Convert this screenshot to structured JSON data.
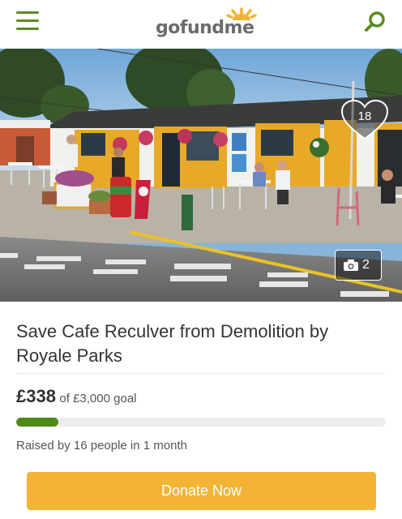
{
  "header": {
    "menu_icon": "hamburger-menu-icon",
    "logo": {
      "part1": "go",
      "part2": "fund",
      "part3": "me"
    },
    "search_icon": "search-icon",
    "brand_color": "#5d8a22"
  },
  "hero": {
    "like_count": "18",
    "like_icon": "heart-icon",
    "photo_icon": "camera-icon",
    "photo_count": "2"
  },
  "campaign": {
    "title": "Save Cafe Reculver from Demolition by Royale Parks",
    "raised_amount": "£338",
    "goal_text": "of £3,000 goal",
    "progress_fraction": 0.113,
    "progress_color": "#4e8a18",
    "meta": "Raised by 16 people in 1 month"
  },
  "actions": {
    "donate_label": "Donate Now",
    "donate_color": "#f3b436"
  }
}
